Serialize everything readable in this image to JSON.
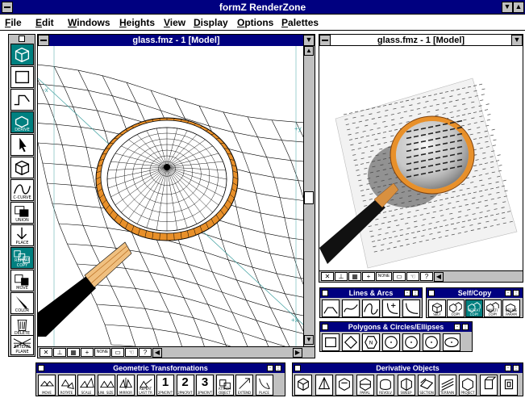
{
  "app": {
    "title": "formZ RenderZone"
  },
  "menu": [
    "File",
    "Edit",
    "Windows",
    "Heights",
    "View",
    "Display",
    "Options",
    "Palettes"
  ],
  "menu_underline": [
    "F",
    "E",
    "W",
    "H",
    "V",
    "D",
    "O",
    "P"
  ],
  "left_window": {
    "title": "glass.fmz - 1 [Model]",
    "axis_x": "-x",
    "axis_y": "+y",
    "axis_neg_y": "-y",
    "axis_z": "+x"
  },
  "right_window": {
    "title": "glass.fmz - 1 [Model]"
  },
  "left_tools": [
    {
      "icon": "cube-icon",
      "label": ""
    },
    {
      "icon": "rectangle-icon",
      "label": ""
    },
    {
      "icon": "extrude-icon",
      "label": ""
    },
    {
      "icon": "derive-icon",
      "label": "DERIVE"
    },
    {
      "icon": "pointer-icon",
      "label": ""
    },
    {
      "icon": "object-cube-icon",
      "label": ""
    },
    {
      "icon": "curve-icon",
      "label": "C-CURVE"
    },
    {
      "icon": "union-icon",
      "label": "UNION"
    },
    {
      "icon": "place-icon",
      "label": "PLACE"
    },
    {
      "icon": "repeat-icon",
      "label": "REPEAT COPY"
    },
    {
      "icon": "move-icon",
      "label": "MOVE"
    },
    {
      "icon": "color-icon",
      "label": "COLOR"
    },
    {
      "icon": "delete-icon",
      "label": "DELETE"
    },
    {
      "icon": "extend-plane-icon",
      "label": "EXTEND PLANE"
    }
  ],
  "status_items": [
    "NONE"
  ],
  "palettes": {
    "lines_arcs": {
      "title": "Lines & Arcs"
    },
    "self_copy": {
      "title": "Self/Copy",
      "buttons": [
        "SELF",
        "COPY",
        "REPEAT COPY",
        "MULTI COPY",
        "DEFINE PARAM"
      ]
    },
    "polygons": {
      "title": "Polygons & Circles/Ellipses"
    },
    "geo_transform": {
      "title": "Geometric Transformations",
      "buttons": [
        "MOVE",
        "ROTATE",
        "SCALE",
        "UNI. SIZE",
        "MIRROR",
        "REPEAT LAST TR",
        "1",
        "2",
        "3",
        "ATTACH OBJECT",
        "EXTEND",
        "PLACE"
      ],
      "sub": [
        "",
        "",
        "",
        "",
        "",
        "",
        "2PNCRVT",
        "2PNCRVT",
        "3PNCRVT",
        "",
        "",
        ""
      ]
    },
    "derivative": {
      "title": "Derivative Objects",
      "buttons": [
        "",
        "",
        "",
        "PARAL",
        "REVOLV",
        "SWEEP",
        "SECTION",
        "TERRAIN",
        "PROJECT",
        "",
        ""
      ]
    }
  },
  "colors": {
    "titlebar": "#000080",
    "selected": "#008080",
    "frame": "#c0c0c0",
    "wood": "#e8902a"
  }
}
